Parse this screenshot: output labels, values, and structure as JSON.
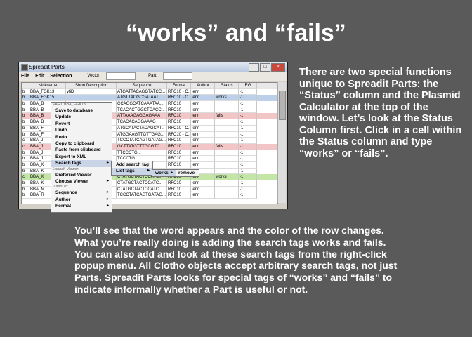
{
  "slide": {
    "title": "“works” and “fails”",
    "right_text": "There are two special functions unique to Spreadit Parts:  the “Status” column and the Plasmid Calculator at the top of the window.  Let’s look at the Status Column first. Click in a cell within the Status column and type “works” or “fails”.",
    "bottom_text": "You’ll see that the word appears and the color of the row changes.  What you’re really doing is adding the search tags works and fails.  You can also add and look at these search tags from the right-click popup menu. All Clotho objects accept arbitrary search tags, not just Parts. Spreadit Parts looks for special tags of “works” and “fails” to indicate informally whether a Part is useful or not."
  },
  "window": {
    "title": "Spreadit Parts",
    "menus": [
      "File",
      "Edit",
      "Selection"
    ],
    "vector_label": "Vector:",
    "part_label": "Part:"
  },
  "table": {
    "columns": [
      "",
      "Nickname",
      "Short Description",
      "Sequence",
      "Format",
      "Author",
      "Status",
      "RG"
    ],
    "rows": [
      {
        "cells": [
          "b",
          "BBA_FGK13",
          "yfiD",
          "ATGATTACAGGTATCC...",
          "RFC10 - C...",
          "jenn",
          "",
          "-1"
        ],
        "state": ""
      },
      {
        "cells": [
          "b",
          "BBA_FGK15",
          "",
          "ATGTTACGCGATAAT...",
          "RFC10 - C...",
          "jenn",
          "works",
          "-1"
        ],
        "state": "selected"
      },
      {
        "cells": [
          "b",
          "BBA_B",
          "",
          "CCAGGCATCAAATAA...",
          "RFC10",
          "jenn",
          "",
          "-1"
        ],
        "state": ""
      },
      {
        "cells": [
          "b",
          "BBA_B",
          "",
          "TCACACTGGCTCACC...",
          "RFC10",
          "jenn",
          "",
          "-1"
        ],
        "state": ""
      },
      {
        "cells": [
          "b",
          "BBA_B",
          "",
          "ATTAAAGAGGAGAAA",
          "RFC10",
          "jenn",
          "fails",
          "-1"
        ],
        "state": "fails"
      },
      {
        "cells": [
          "b",
          "BBA_B",
          "",
          "TCACACAGGAAAG",
          "RFC10",
          "jenn",
          "",
          "-1"
        ],
        "state": ""
      },
      {
        "cells": [
          "b",
          "BBA_F",
          "",
          "ATGCATACTACAGCAT...",
          "RFC10 - C...",
          "jenn",
          "",
          "-1"
        ],
        "state": ""
      },
      {
        "cells": [
          "b",
          "BBA_F",
          "",
          "ATGGAAGTTGTTGAG...",
          "RFC10 - C...",
          "jenn",
          "",
          "-1"
        ],
        "state": ""
      },
      {
        "cells": [
          "c",
          "BBA_J",
          "",
          "TCCCTATCAGTGATAG...",
          "RFC10",
          "jenn",
          "",
          "-1"
        ],
        "state": ""
      },
      {
        "cells": [
          "c",
          "BBA_J",
          "32",
          "GCTTATGTTTGCGTC...",
          "RFC10",
          "jenn",
          "fails",
          "-1"
        ],
        "state": "fails"
      },
      {
        "cells": [
          "b",
          "BBA_J",
          "",
          "TTCCCTG...",
          "RFC10",
          "jenn",
          "",
          "-1"
        ],
        "state": ""
      },
      {
        "cells": [
          "b",
          "BBA_J",
          "",
          "TCCCTG...",
          "RFC10",
          "jenn",
          "",
          "-1"
        ],
        "state": ""
      },
      {
        "cells": [
          "b",
          "BBA_K",
          "",
          "...",
          "RFC10",
          "jenn",
          "",
          "-1"
        ],
        "state": ""
      },
      {
        "cells": [
          "b",
          "BBA_K",
          "",
          "...",
          "RFC10",
          "jenn",
          "",
          "-1"
        ],
        "state": ""
      },
      {
        "cells": [
          "c",
          "BBA_K",
          "K19...",
          "CTATGCTACTCCATC...",
          "RFC10",
          "jenn",
          "works",
          "-1"
        ],
        "state": "works"
      },
      {
        "cells": [
          "b",
          "BBA_K",
          "",
          "CTATGCTACTCCATC...",
          "RFC10",
          "jenn",
          "",
          "-1"
        ],
        "state": ""
      },
      {
        "cells": [
          "b",
          "BBA_M",
          "",
          "CTATGCTACTCCATC...",
          "RFC10",
          "jenn",
          "",
          "-1"
        ],
        "state": ""
      },
      {
        "cells": [
          "b",
          "BBA_R",
          "",
          "TCCCTATCAGTGATAG...",
          "RFC10",
          "jenn",
          "",
          "-1"
        ],
        "state": ""
      }
    ]
  },
  "context_menu": {
    "items": [
      {
        "label": "PART BBA_FGK15",
        "type": "section"
      },
      {
        "label": "Save to database"
      },
      {
        "label": "Update"
      },
      {
        "label": "Revert"
      },
      {
        "label": "Undo"
      },
      {
        "label": "Redo"
      },
      {
        "label": "Copy to clipboard"
      },
      {
        "label": "Paste from clipboard"
      },
      {
        "label": "Export to XML"
      },
      {
        "label": "Search tags",
        "submenu": true,
        "highlight": true
      },
      {
        "label": "Launch Viewer:",
        "type": "section"
      },
      {
        "label": "Preferred Viewer"
      },
      {
        "label": "Choose Viewer",
        "submenu": true
      },
      {
        "label": "Jump To:",
        "type": "section"
      },
      {
        "label": "Sequence",
        "submenu": true
      },
      {
        "label": "Author",
        "submenu": true
      },
      {
        "label": "Format",
        "submenu": true
      }
    ],
    "search_tags_submenu": [
      "Add search tag",
      "List tags"
    ],
    "list_tags_submenu": [
      "works",
      "remove"
    ]
  }
}
